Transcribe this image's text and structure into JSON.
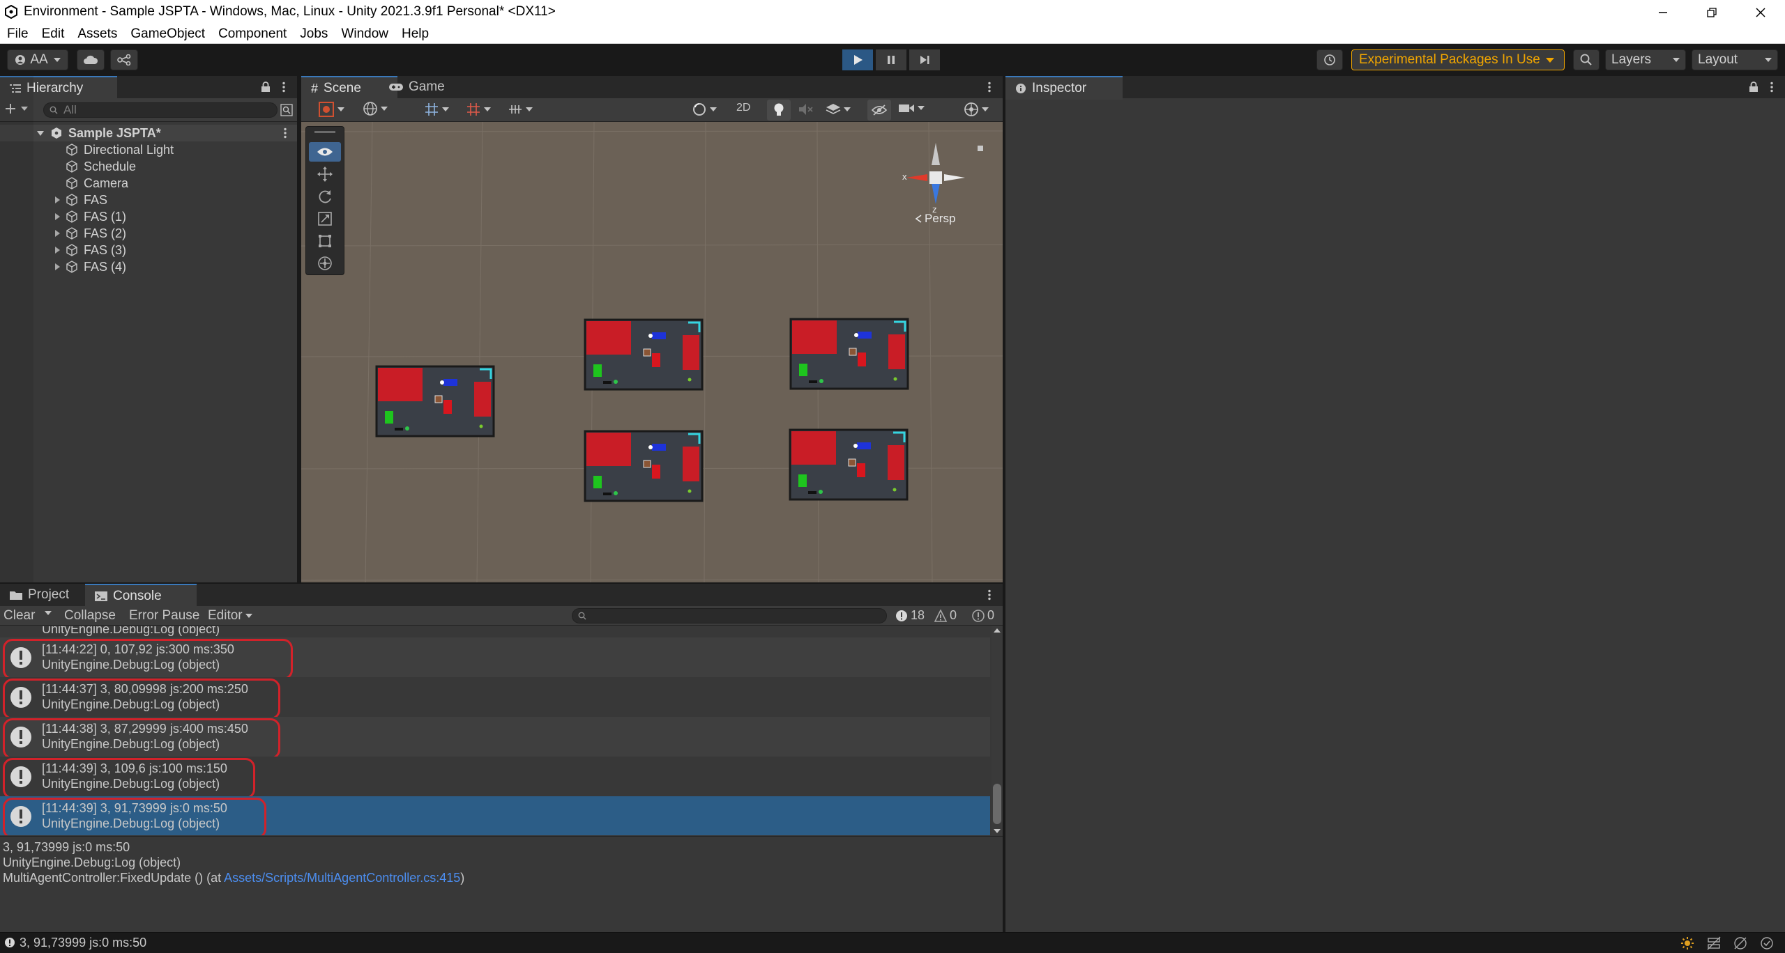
{
  "window": {
    "title": "Environment - Sample JSPTA - Windows, Mac, Linux - Unity 2021.3.9f1 Personal* <DX11>"
  },
  "menu": [
    "File",
    "Edit",
    "Assets",
    "GameObject",
    "Component",
    "Jobs",
    "Window",
    "Help"
  ],
  "toolbar": {
    "account_label": "AA",
    "experimental_label": "Experimental Packages In Use",
    "layers_label": "Layers",
    "layout_label": "Layout",
    "accent_color": "#f0a500"
  },
  "hierarchy": {
    "tab_label": "Hierarchy",
    "search_placeholder": "All",
    "scene_name": "Sample JSPTA*",
    "items": [
      {
        "label": "Directional Light",
        "expandable": false
      },
      {
        "label": "Schedule",
        "expandable": false
      },
      {
        "label": "Camera",
        "expandable": false
      },
      {
        "label": "FAS",
        "expandable": true
      },
      {
        "label": "FAS (1)",
        "expandable": true
      },
      {
        "label": "FAS (2)",
        "expandable": true
      },
      {
        "label": "FAS (3)",
        "expandable": true
      },
      {
        "label": "FAS (4)",
        "expandable": true
      }
    ]
  },
  "scene": {
    "tabs": [
      "Scene",
      "Game"
    ],
    "mode_2d_label": "2D",
    "gizmo": {
      "x_label": "x",
      "z_label": "z",
      "projection_label": "Persp"
    },
    "tools": [
      "view-tool",
      "move-tool",
      "rotate-tool",
      "scale-tool",
      "rect-tool",
      "transform-tool"
    ]
  },
  "inspector": {
    "tab_label": "Inspector"
  },
  "console": {
    "tabs": [
      "Project",
      "Console"
    ],
    "buttons": {
      "clear": "Clear",
      "collapse": "Collapse",
      "error_pause": "Error Pause",
      "editor": "Editor"
    },
    "counts": {
      "logs": "18",
      "warnings": "0",
      "errors": "0"
    },
    "partial_row_label": "UnityEngine.Debug:Log (object)",
    "rows": [
      {
        "line1": "[11:44:22] 0, 107,92 js:300 ms:350",
        "line2": "UnityEngine.Debug:Log (object)",
        "selected": false
      },
      {
        "line1": "[11:44:37] 3, 80,09998 js:200 ms:250",
        "line2": "UnityEngine.Debug:Log (object)",
        "selected": false
      },
      {
        "line1": "[11:44:38] 3, 87,29999 js:400 ms:450",
        "line2": "UnityEngine.Debug:Log (object)",
        "selected": false
      },
      {
        "line1": "[11:44:39] 3, 109,6 js:100 ms:150",
        "line2": "UnityEngine.Debug:Log (object)",
        "selected": false
      },
      {
        "line1": "[11:44:39] 3, 91,73999 js:0 ms:50",
        "line2": "UnityEngine.Debug:Log (object)",
        "selected": true
      }
    ],
    "detail": {
      "line1": "3, 91,73999 js:0 ms:50",
      "line2": "UnityEngine.Debug:Log (object)",
      "line3_prefix": "MultiAgentController:FixedUpdate () (at ",
      "line3_link": "Assets/Scripts/MultiAgentController.cs:415",
      "line3_suffix": ")"
    }
  },
  "status": {
    "message": "3, 91,73999 js:0 ms:50"
  }
}
